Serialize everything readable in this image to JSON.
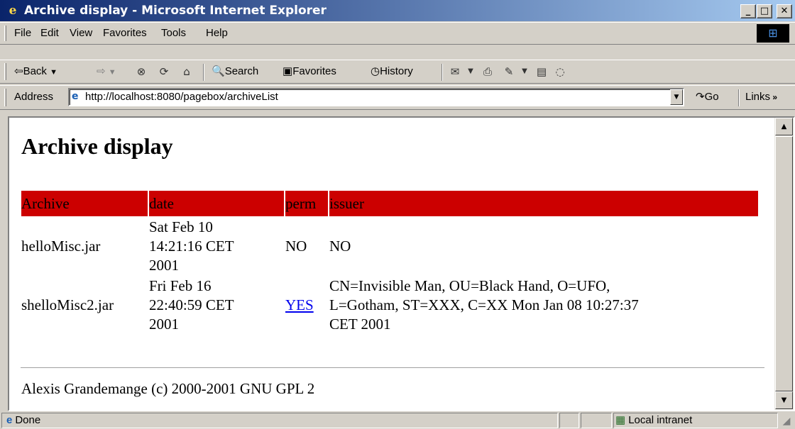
{
  "window": {
    "title": "Archive display - Microsoft Internet Explorer",
    "controls": {
      "minimize": "_",
      "maximize": "□",
      "close": "✕"
    }
  },
  "menu": {
    "items": [
      {
        "label": "File"
      },
      {
        "label": "Edit"
      },
      {
        "label": "View"
      },
      {
        "label": "Favorites"
      },
      {
        "label": "Tools"
      },
      {
        "label": "Help"
      }
    ]
  },
  "toolbar": {
    "back_label": "⇦Back",
    "search_label": "Search",
    "favorites_label": "Favorites",
    "history_label": "History"
  },
  "address_bar": {
    "label": "Address",
    "url": "http://localhost:8080/pagebox/archiveList",
    "go_label": "Go",
    "links_label": "Links"
  },
  "page": {
    "heading": "Archive display",
    "table": {
      "headers": [
        "Archive",
        "date",
        "perm",
        "issuer"
      ],
      "header_color": "#cc0000",
      "rows": [
        {
          "archive": "helloMisc.jar",
          "date_lines": [
            "Sat Feb 10",
            "14:21:16 CET",
            "2001"
          ],
          "perm": "NO",
          "issuer_lines": [
            "NO"
          ]
        },
        {
          "archive": "shelloMisc2.jar",
          "date_lines": [
            "Fri Feb 16",
            "22:40:59 CET",
            "2001"
          ],
          "perm": "YES",
          "issuer_lines": [
            "CN=Invisible Man, OU=Black Hand, O=UFO,",
            "L=Gotham, ST=XXX, C=XX Mon Jan 08 10:27:37",
            "CET 2001"
          ]
        }
      ]
    },
    "footer": "Alexis Grandemange (c) 2000-2001 GNU GPL 2"
  },
  "status_bar": {
    "status_text": "Done",
    "zone_text": "Local intranet"
  }
}
